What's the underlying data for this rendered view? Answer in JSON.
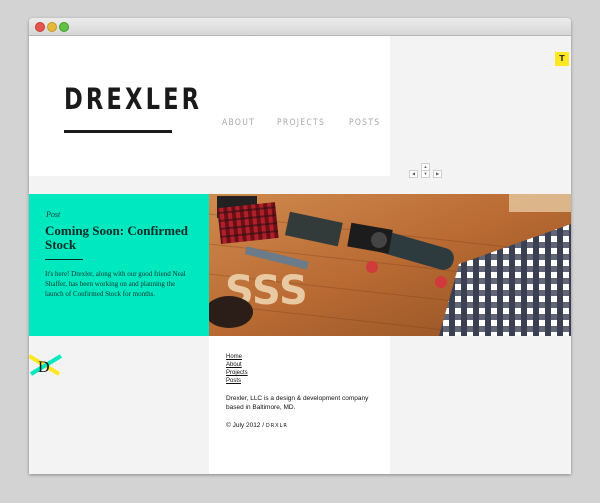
{
  "window": {
    "controls": [
      "close",
      "minimize",
      "zoom"
    ]
  },
  "header": {
    "logo_text": "DREXLER",
    "nav": [
      "ABOUT",
      "PROJECTS",
      "POSTS"
    ],
    "badge_letter": "T"
  },
  "featured_post": {
    "label": "Post",
    "title": "Coming Soon: Confirmed Stock",
    "body": "It's here! Drexler, along with our good friend Neal Shaffer, has been working on and planning the launch of Confirmed Stock for months.",
    "accent_color": "#00e8bf"
  },
  "footer": {
    "links": [
      "Home",
      "About",
      "Projects",
      "Posts"
    ],
    "about_text": "Drexler, LLC is a design & development company based in Baltimore, MD.",
    "copyright_text": "© July 2012 / ",
    "copyright_mark": "DRXLR",
    "d_mark_letter": "D"
  }
}
